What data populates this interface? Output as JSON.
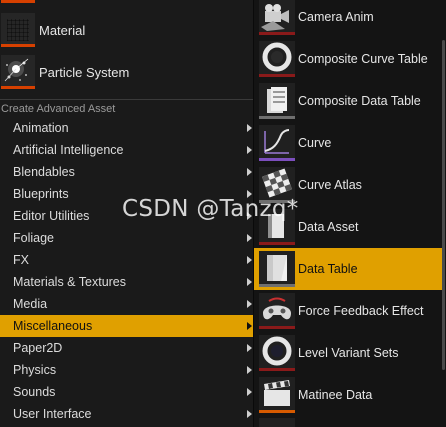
{
  "left_menu": {
    "assets": [
      {
        "label": "Material",
        "icon": "material-sphere-icon"
      },
      {
        "label": "Particle System",
        "icon": "particle-system-icon"
      }
    ],
    "section_header": "Create Advanced Asset",
    "categories": [
      {
        "label": "Animation"
      },
      {
        "label": "Artificial Intelligence"
      },
      {
        "label": "Blendables"
      },
      {
        "label": "Blueprints"
      },
      {
        "label": "Editor Utilities"
      },
      {
        "label": "Foliage"
      },
      {
        "label": "FX"
      },
      {
        "label": "Materials & Textures"
      },
      {
        "label": "Media"
      },
      {
        "label": "Miscellaneous"
      },
      {
        "label": "Paper2D"
      },
      {
        "label": "Physics"
      },
      {
        "label": "Sounds"
      },
      {
        "label": "User Interface"
      }
    ],
    "highlighted": "Miscellaneous"
  },
  "submenu": {
    "items": [
      {
        "label": "Camera Anim",
        "icon": "camera-anim-icon"
      },
      {
        "label": "Composite Curve Table",
        "icon": "composite-curve-table-icon"
      },
      {
        "label": "Composite Data Table",
        "icon": "composite-data-table-icon"
      },
      {
        "label": "Curve",
        "icon": "curve-icon"
      },
      {
        "label": "Curve Atlas",
        "icon": "curve-atlas-icon"
      },
      {
        "label": "Data Asset",
        "icon": "data-asset-icon"
      },
      {
        "label": "Data Table",
        "icon": "data-table-icon"
      },
      {
        "label": "Force Feedback Effect",
        "icon": "force-feedback-icon"
      },
      {
        "label": "Level Variant Sets",
        "icon": "level-variant-sets-icon"
      },
      {
        "label": "Matinee Data",
        "icon": "matinee-data-icon"
      }
    ],
    "highlighted": "Data Table"
  },
  "watermark": {
    "text": "CSDN @Tanzq*"
  },
  "colors": {
    "highlight": "#e0a000",
    "background": "#1a1a1a",
    "text": "#e6e6e6"
  }
}
